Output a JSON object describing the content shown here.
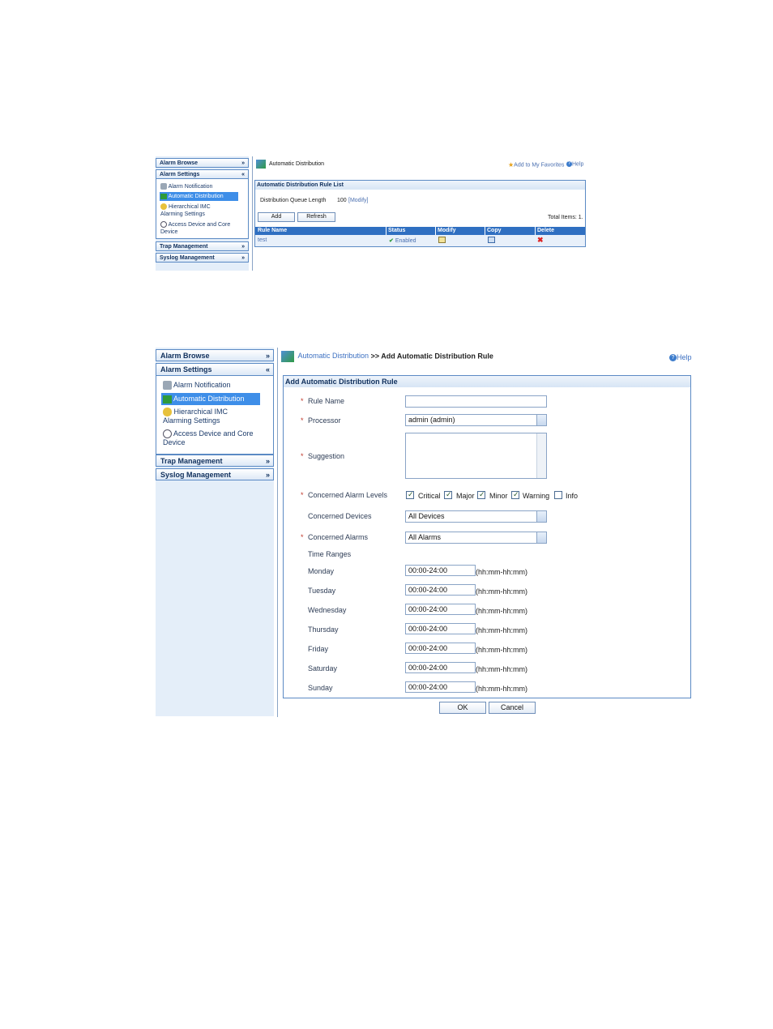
{
  "fig1": {
    "sidebar": {
      "alarm_browse": "Alarm Browse",
      "alarm_settings": "Alarm Settings",
      "items": [
        "Alarm Notification",
        "Automatic Distribution",
        "Hierarchical IMC",
        "Alarming Settings",
        "Access Device and Core",
        "Device"
      ],
      "trap_management": "Trap Management",
      "syslog_management": "Syslog Management"
    },
    "page_title": "Automatic Distribution",
    "add_favorites": "Add to My Favorites",
    "help": "Help",
    "section_title": "Automatic Distribution Rule List",
    "queue_label": "Distribution Queue Length",
    "queue_value": "100",
    "queue_modify": "[Modify]",
    "add_button": "Add",
    "refresh_button": "Refresh",
    "total_items": "Total Items: 1.",
    "columns": [
      "Rule Name",
      "Status",
      "Modify",
      "Copy",
      "Delete"
    ],
    "row": {
      "rule_name": "test",
      "status": "Enabled"
    }
  },
  "fig2": {
    "sidebar": {
      "alarm_browse": "Alarm Browse",
      "alarm_settings": "Alarm Settings",
      "items": [
        "Alarm Notification",
        "Automatic Distribution",
        "Hierarchical IMC",
        "Alarming Settings",
        "Access Device and Core",
        "Device"
      ],
      "trap_management": "Trap Management",
      "syslog_management": "Syslog Management"
    },
    "breadcrumb_link": "Automatic Distribution",
    "breadcrumb_rest": ">> Add Automatic Distribution Rule",
    "help": "Help",
    "section_title": "Add Automatic Distribution Rule",
    "labels": {
      "rule_name": "Rule Name",
      "processor": "Processor",
      "suggestion": "Suggestion",
      "levels": "Concerned Alarm Levels",
      "devices": "Concerned Devices",
      "alarms": "Concerned Alarms",
      "time_ranges": "Time Ranges"
    },
    "required_mark": "*",
    "processor_value": "admin (admin)",
    "devices_value": "All Devices",
    "alarms_value": "All Alarms",
    "levels": [
      {
        "label": "Critical",
        "checked": true
      },
      {
        "label": "Major",
        "checked": true
      },
      {
        "label": "Minor",
        "checked": true
      },
      {
        "label": "Warning",
        "checked": true
      },
      {
        "label": "Info",
        "checked": false
      }
    ],
    "days": [
      {
        "day": "Monday",
        "value": "00:00-24:00"
      },
      {
        "day": "Tuesday",
        "value": "00:00-24:00"
      },
      {
        "day": "Wednesday",
        "value": "00:00-24:00"
      },
      {
        "day": "Thursday",
        "value": "00:00-24:00"
      },
      {
        "day": "Friday",
        "value": "00:00-24:00"
      },
      {
        "day": "Saturday",
        "value": "00:00-24:00"
      },
      {
        "day": "Sunday",
        "value": "00:00-24:00"
      }
    ],
    "time_format": "(hh:mm-hh:mm)",
    "ok_button": "OK",
    "cancel_button": "Cancel"
  }
}
